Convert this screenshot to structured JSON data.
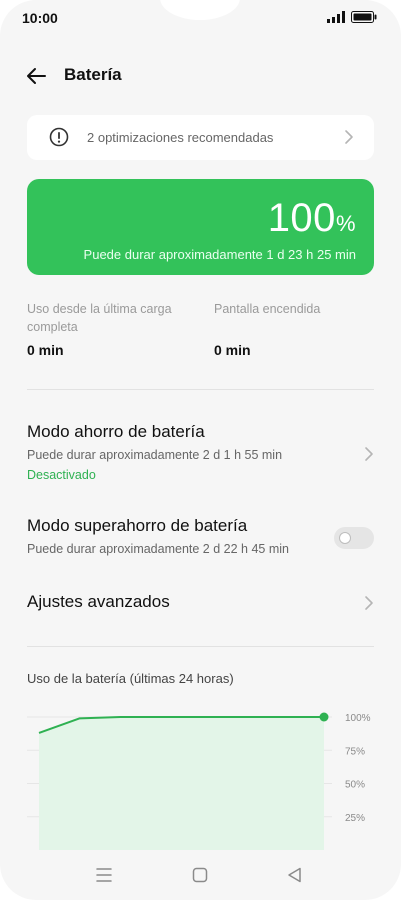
{
  "status_bar": {
    "time": "10:00",
    "icons": [
      "signal-icon",
      "battery-icon"
    ]
  },
  "header": {
    "title": "Batería",
    "back_icon": "arrow-left-icon"
  },
  "optimizations": {
    "text": "2 optimizaciones recomendadas",
    "icon": "exclamation-circle-icon"
  },
  "battery": {
    "percent": "100",
    "percent_sign": "%",
    "estimate": "Puede durar aproximadamente 1 d 23 h 25 min",
    "card_color": "#33c25a"
  },
  "stats": [
    {
      "label": "Uso desde la última carga completa",
      "value": "0 min"
    },
    {
      "label": "Pantalla encendida",
      "value": "0 min"
    }
  ],
  "modes": {
    "saver": {
      "title": "Modo ahorro de batería",
      "subtitle": "Puede durar aproximadamente 2 d 1 h 55 min",
      "status": "Desactivado"
    },
    "super_saver": {
      "title": "Modo superahorro de batería",
      "subtitle": "Puede durar aproximadamente 2 d 22 h 45 min",
      "toggle_on": false
    },
    "advanced": {
      "title": "Ajustes avanzados"
    }
  },
  "chart_title": "Uso de la batería (últimas 24 horas)",
  "chart_data": {
    "type": "area",
    "title": "Uso de la batería (últimas 24 horas)",
    "xlabel": "",
    "ylabel": "",
    "x": [
      0,
      1,
      2,
      3,
      4,
      5,
      6,
      7
    ],
    "values": [
      88,
      99,
      100,
      100,
      100,
      100,
      100,
      100
    ],
    "y_ticks": [
      "100%",
      "75%",
      "50%",
      "25%"
    ],
    "y_tick_values": [
      100,
      75,
      50,
      25
    ],
    "ylim": [
      0,
      100
    ],
    "line_color": "#2fb152",
    "fill_color": "#e3f5e8",
    "grid": true
  },
  "nav_bar": {
    "buttons": [
      "menu-icon",
      "home-square-icon",
      "back-triangle-icon"
    ]
  },
  "colors": {
    "accent": "#33c25a",
    "status_green": "#2fb152"
  }
}
